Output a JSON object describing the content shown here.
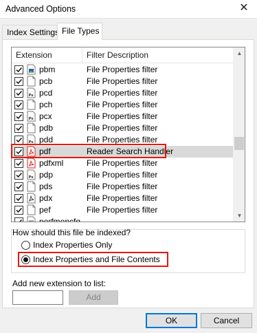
{
  "window": {
    "title": "Advanced Options",
    "close_glyph": "✕"
  },
  "tabs": [
    {
      "label": "Index Settings",
      "active": false
    },
    {
      "label": "File Types",
      "active": true
    }
  ],
  "list": {
    "columns": {
      "extension": "Extension",
      "description": "Filter Description"
    },
    "rows": [
      {
        "ext": "pbm",
        "desc": "File Properties filter",
        "checked": true,
        "icon": "image-file-icon"
      },
      {
        "ext": "pcb",
        "desc": "File Properties filter",
        "checked": true,
        "icon": "blank-file-icon"
      },
      {
        "ext": "pcd",
        "desc": "File Properties filter",
        "checked": true,
        "icon": "ps-file-icon"
      },
      {
        "ext": "pch",
        "desc": "File Properties filter",
        "checked": true,
        "icon": "blank-file-icon"
      },
      {
        "ext": "pcx",
        "desc": "File Properties filter",
        "checked": true,
        "icon": "ps-file-icon"
      },
      {
        "ext": "pdb",
        "desc": "File Properties filter",
        "checked": true,
        "icon": "blank-file-icon"
      },
      {
        "ext": "pdd",
        "desc": "File Properties filter",
        "checked": true,
        "icon": "ps-file-icon"
      },
      {
        "ext": "pdf",
        "desc": "Reader Search Handler",
        "checked": true,
        "icon": "pdf-file-icon",
        "selected": true
      },
      {
        "ext": "pdfxml",
        "desc": "File Properties filter",
        "checked": true,
        "icon": "pdf-file-icon"
      },
      {
        "ext": "pdp",
        "desc": "File Properties filter",
        "checked": true,
        "icon": "ps-file-icon"
      },
      {
        "ext": "pds",
        "desc": "File Properties filter",
        "checked": true,
        "icon": "blank-file-icon"
      },
      {
        "ext": "pdx",
        "desc": "File Properties filter",
        "checked": true,
        "icon": "acrobat-file-icon"
      },
      {
        "ext": "pef",
        "desc": "File Properties filter",
        "checked": true,
        "icon": "blank-file-icon"
      },
      {
        "ext": "perfmoncfg",
        "desc": "",
        "checked": true,
        "icon": "lines-file-icon"
      }
    ]
  },
  "index_options": {
    "question": "How should this file be indexed?",
    "option_properties": "Index Properties Only",
    "option_contents": "Index Properties and File Contents",
    "selected": "contents"
  },
  "add_extension": {
    "label": "Add new extension to list:",
    "value": "",
    "button": "Add"
  },
  "footer": {
    "ok": "OK",
    "cancel": "Cancel"
  },
  "colors": {
    "highlight": "#e8170e",
    "selection": "#d9d9d9",
    "focus": "#0078d7",
    "pdf_red": "#d7261b"
  }
}
